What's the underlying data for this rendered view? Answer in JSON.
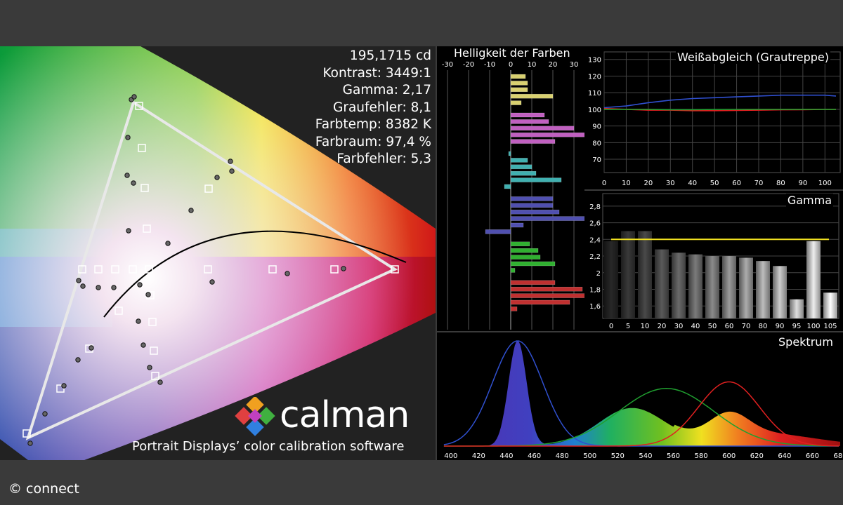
{
  "stats": {
    "luminance": "195,1715 cd",
    "contrast": "Kontrast: 3449:1",
    "gamma": "Gamma: 2,17",
    "grey_error": "Graufehler: 8,1",
    "color_temp": "Farbtemp: 8382 K",
    "color_space": "Farbraum: 97,4 %",
    "color_error": "Farbfehler: 5,3"
  },
  "brand": {
    "name": "calman",
    "tagline": "Portrait Displays’ color calibration software"
  },
  "copyright": "© connect",
  "colors": {
    "red": "#e02020",
    "green": "#20a030",
    "blue": "#3050d0",
    "gamma_target": "#f0e020"
  },
  "chart_data": [
    {
      "type": "bar",
      "orientation": "horizontal",
      "title": "Helligkeit der Farben",
      "xlim": [
        -35,
        35
      ],
      "x_ticks": [
        "-30",
        "-20",
        "-10",
        "0",
        "10",
        "20",
        "30"
      ],
      "groups": [
        {
          "color": "#d8d070",
          "values": [
            7,
            8,
            8,
            20,
            5
          ]
        },
        {
          "color": "#c060c0",
          "values": [
            16,
            18,
            30,
            45,
            21
          ]
        },
        {
          "color": "#40b0b0",
          "values": [
            -1,
            8,
            10,
            12,
            24,
            -3
          ]
        },
        {
          "color": "#5050b0",
          "values": [
            20,
            20,
            23,
            45,
            6,
            -12
          ]
        },
        {
          "color": "#30b030",
          "values": [
            9,
            13,
            14,
            21,
            2
          ]
        },
        {
          "color": "#c03030",
          "values": [
            21,
            34,
            41,
            28,
            3
          ]
        }
      ]
    },
    {
      "type": "line",
      "title": "Weißabgleich (Grautreppe)",
      "x": [
        0,
        10,
        20,
        30,
        40,
        50,
        60,
        70,
        80,
        90,
        100,
        105
      ],
      "x_ticks": [
        "0",
        "10",
        "20",
        "30",
        "40",
        "50",
        "60",
        "70",
        "80",
        "90",
        "100"
      ],
      "y_ticks": [
        "70",
        "80",
        "90",
        "100",
        "110",
        "120",
        "130"
      ],
      "xlim": [
        0,
        105
      ],
      "ylim": [
        62,
        132
      ],
      "series": [
        {
          "color": "#3050d0",
          "values": [
            101,
            102,
            104,
            105.5,
            106.5,
            107,
            107.5,
            108,
            108.5,
            108.5,
            108.5,
            108
          ]
        },
        {
          "color": "#e02020",
          "values": [
            100.5,
            100,
            99.5,
            99.5,
            99.2,
            99.2,
            99.3,
            99.5,
            99.7,
            99.8,
            100,
            100
          ]
        },
        {
          "color": "#20a030",
          "values": [
            100,
            100,
            100,
            99.8,
            99.8,
            99.9,
            100,
            100,
            100,
            100,
            100,
            100
          ]
        }
      ]
    },
    {
      "type": "bar",
      "title": "Gamma",
      "categories": [
        "0",
        "5",
        "10",
        "20",
        "30",
        "40",
        "50",
        "60",
        "70",
        "80",
        "90",
        "95",
        "100",
        "105"
      ],
      "values": [
        2.38,
        2.5,
        2.5,
        2.28,
        2.24,
        2.22,
        2.2,
        2.2,
        2.18,
        2.14,
        2.08,
        1.68,
        2.38,
        1.76
      ],
      "y_ticks": [
        "1,6",
        "1,8",
        "2",
        "2,2",
        "2,4",
        "2,6",
        "2,8"
      ],
      "ylim": [
        1.45,
        2.9
      ],
      "target": 2.4
    },
    {
      "type": "line",
      "title": "Spektrum",
      "x_ticks": [
        "400",
        "420",
        "440",
        "460",
        "480",
        "500",
        "520",
        "540",
        "560",
        "580",
        "600",
        "620",
        "640",
        "660",
        "680"
      ],
      "xlim": [
        390,
        682
      ],
      "series": [
        {
          "color": "#3050d0",
          "peak_nm": 448,
          "width_nm": 18,
          "amplitude": 0.95
        },
        {
          "color": "#20a030",
          "peak_nm": 555,
          "width_nm": 34,
          "amplitude": 0.52
        },
        {
          "color": "#e02020",
          "peak_nm": 600,
          "width_nm": 22,
          "amplitude": 0.58
        }
      ]
    },
    {
      "type": "scatter",
      "title": "",
      "gamut_triangle": [
        [
          0.64,
          0.33
        ],
        [
          0.3,
          0.6
        ],
        [
          0.15,
          0.06
        ]
      ]
    }
  ]
}
